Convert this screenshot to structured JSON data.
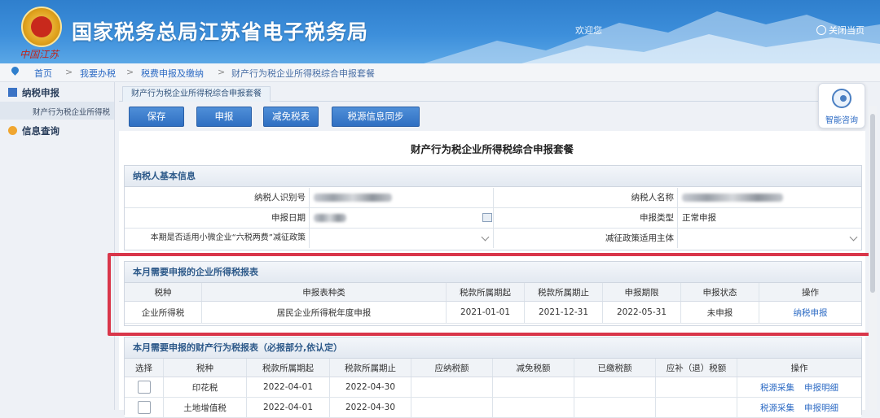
{
  "header": {
    "site_title": "国家税务总局江苏省电子税务局",
    "welcome_text": "欢迎您",
    "close_label": "关闭当页",
    "signature": "中国江苏"
  },
  "breadcrumb": {
    "items": [
      "首页",
      "我要办税",
      "税费申报及缴纳",
      "财产行为税企业所得税综合申报套餐"
    ],
    "separator": ">"
  },
  "sidebar": {
    "sections": [
      {
        "label": "纳税申报",
        "children": [
          "财产行为税企业所得税"
        ]
      },
      {
        "label": "信息查询",
        "children": []
      }
    ]
  },
  "tab": {
    "label": "财产行为税企业所得税综合申报套餐"
  },
  "toolbar": {
    "save": "保存",
    "declare": "申报",
    "reduce": "减免税表",
    "sync": "税源信息同步"
  },
  "assistant": {
    "label": "智能咨询"
  },
  "page_title": "财产行为税企业所得税综合申报套餐",
  "basic_info": {
    "heading": "纳税人基本信息",
    "taxpayer_id_label": "纳税人识别号",
    "taxpayer_name_label": "纳税人名称",
    "declare_date_label": "申报日期",
    "declare_type_label": "申报类型",
    "declare_type_value": "正常申报",
    "small_policy_label": "本期是否适用小微企业“六税两费”减征政策",
    "reduction_subject_label": "减征政策适用主体"
  },
  "income_tax": {
    "heading": "本月需要申报的企业所得税报表",
    "columns": [
      "税种",
      "申报表种类",
      "税款所属期起",
      "税款所属期止",
      "申报期限",
      "申报状态",
      "操作"
    ],
    "rows": [
      {
        "tax": "企业所得税",
        "form": "居民企业所得税年度申报",
        "start": "2021-01-01",
        "end": "2021-12-31",
        "deadline": "2022-05-31",
        "status": "未申报",
        "action": "纳税申报"
      }
    ]
  },
  "property_tax": {
    "heading": "本月需要申报的财产行为税报表（必报部分,依认定）",
    "columns": [
      "选择",
      "税种",
      "税款所属期起",
      "税款所属期止",
      "应纳税额",
      "减免税额",
      "已缴税额",
      "应补（退）税额",
      "操作"
    ],
    "rows": [
      {
        "tax": "印花税",
        "start": "2022-04-01",
        "end": "2022-04-30",
        "action1": "税源采集",
        "action2": "申报明细"
      },
      {
        "tax": "土地增值税",
        "start": "2022-04-01",
        "end": "2022-04-30",
        "action1": "税源采集",
        "action2": "申报明细"
      }
    ]
  },
  "colors": {
    "header_blue": "#3d8fdb",
    "button_blue": "#2f6fc2",
    "highlight_red": "#d9364a",
    "link_blue": "#2d6bc4"
  }
}
